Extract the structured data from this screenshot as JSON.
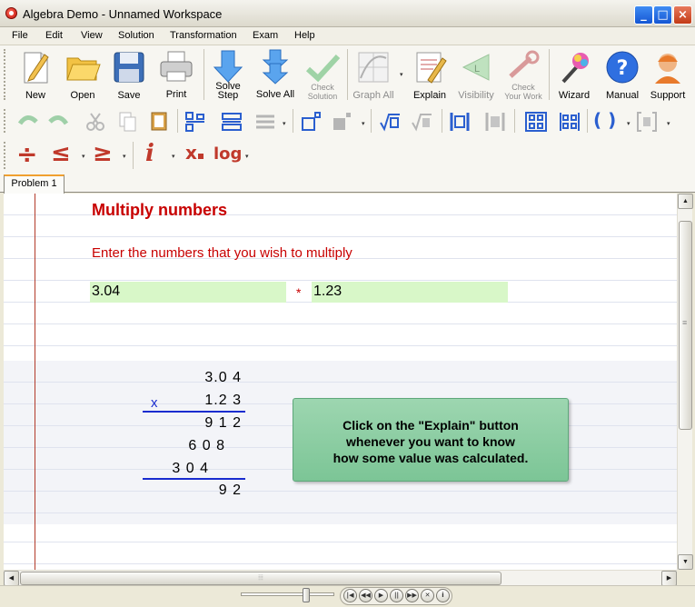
{
  "window": {
    "title": "Algebra Demo - Unnamed Workspace",
    "controls": {
      "minimize": "_",
      "maximize": "□",
      "close": "×"
    }
  },
  "menu": [
    "File",
    "Edit",
    "View",
    "Solution",
    "Transformation",
    "Exam",
    "Help"
  ],
  "toolbar": {
    "new": "New",
    "open": "Open",
    "save": "Save",
    "print": "Print",
    "solve_step_line1": "Solve",
    "solve_step_line2": "Step",
    "solve_all": "Solve All",
    "check_solution_line1": "Check",
    "check_solution_line2": "Solution",
    "graph_all": "Graph All",
    "explain": "Explain",
    "visibility": "Visibility",
    "check_work_line1": "Check",
    "check_work_line2": "Your Work",
    "wizard": "Wizard",
    "manual": "Manual",
    "support": "Support"
  },
  "math_toolbar": {
    "divide": "÷",
    "less_equal": "≤",
    "greater_equal": "≥",
    "imaginary": "i",
    "subscript_x": "x",
    "log": "log",
    "parens": "( )",
    "dropdown": "▾"
  },
  "tabs": [
    "Problem 1"
  ],
  "problem": {
    "heading": "Multiply numbers",
    "prompt": "Enter the numbers that you wish to multiply",
    "value_a": "3.04",
    "operator": "*",
    "value_b": "1.23"
  },
  "long_multiplication": {
    "multiplicand": "3.0 4",
    "times_sign": "x",
    "multiplier": "1.2 3",
    "partial_1": "9 1 2",
    "partial_2": "6 0 8",
    "partial_3": "3 0 4",
    "result": "9 2"
  },
  "hint": {
    "line1": "Click on the \"Explain\" button",
    "line2": "whenever you want to know",
    "line3": "how some value was calculated."
  },
  "scrollbars": {
    "up": "▲",
    "down": "▼",
    "left": "◀",
    "right": "▶",
    "grip_v": "≡",
    "grip_h": "⦙⦙⦙"
  },
  "playback": [
    "|◀",
    "◀◀",
    "▶",
    "||",
    "▶▶",
    "✕",
    "i"
  ],
  "colors": {
    "accent_red": "#c80000",
    "field_green": "#d8f7c8",
    "hint_green": "#8ccea3",
    "rule_blue": "#1a2ccf",
    "margin_red": "#b23a2a"
  }
}
